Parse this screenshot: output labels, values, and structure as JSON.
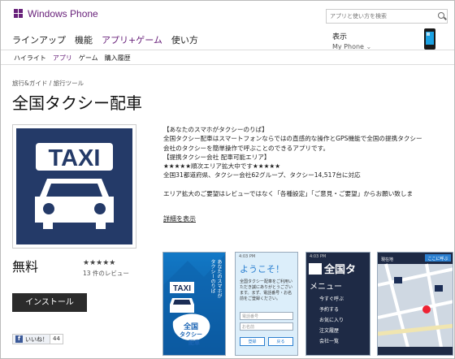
{
  "header": {
    "brand": "Windows Phone",
    "search_placeholder": "アプリと使い方を検索"
  },
  "main_nav": [
    "ラインアップ",
    "機能",
    "アプリ+ゲーム",
    "使い方"
  ],
  "main_nav_active": 2,
  "display": {
    "label": "表示",
    "value": "My Phone",
    "arrow": "⌄"
  },
  "sub_nav": [
    "ハイライト",
    "アプリ",
    "ゲーム",
    "購入履歴"
  ],
  "sub_nav_active": 1,
  "breadcrumb": "旅行&ガイド / 旅行ツール",
  "app": {
    "title": "全国タクシー配車",
    "icon_text": "TAXI",
    "price": "無料",
    "stars": "★★★★★",
    "rating": 4.5,
    "reviews": "13 件のレビュー",
    "install": "インストール"
  },
  "description": {
    "lines": [
      "【あなたのスマホがタクシーのりば】",
      "全国タクシー配車はスマートフォンならではの直感的な操作とGPS機能で全国の提携タクシー",
      "会社のタクシーを簡単操作で呼ぶことのできるアプリです。",
      "【提携タクシー会社 配車可能エリア】",
      "★★★★★順次エリア拡大中です★★★★★",
      "全国31都道府県、タクシー会社62グループ、タクシー14,517台に対応",
      "",
      "エリア拡大のご要望はレビューではなく「各種設定」「ご意見・ご要望」からお願い致しま"
    ],
    "more": "詳細を表示"
  },
  "social": {
    "like": "いいね！",
    "count": "44",
    "fb": "f"
  },
  "screenshots": [
    {
      "taxi": "TAXI",
      "vertical": "あなたのスマホが\nタクシーのりば",
      "brand1": "全国",
      "brand2": "タクシー",
      "brand3": "配車"
    },
    {
      "status": "4:03 PM",
      "welcome": "ようこそ！",
      "body": "全国タクシー配車をご利用いただき誠にありがとうございます。まず、電話番号・お名前をご登録ください。",
      "field1": "電話番号",
      "field2": "お名前",
      "btn1": "登録",
      "btn2": "戻る"
    },
    {
      "status": "4:03 PM",
      "title": "全国タ",
      "menu": "メニュー",
      "items": [
        "今すぐ呼ぶ",
        "予約する",
        "お気に入り",
        "注文履歴",
        "会社一覧"
      ]
    },
    {
      "status": "現在地",
      "btn": "ここに呼ぶ"
    }
  ]
}
